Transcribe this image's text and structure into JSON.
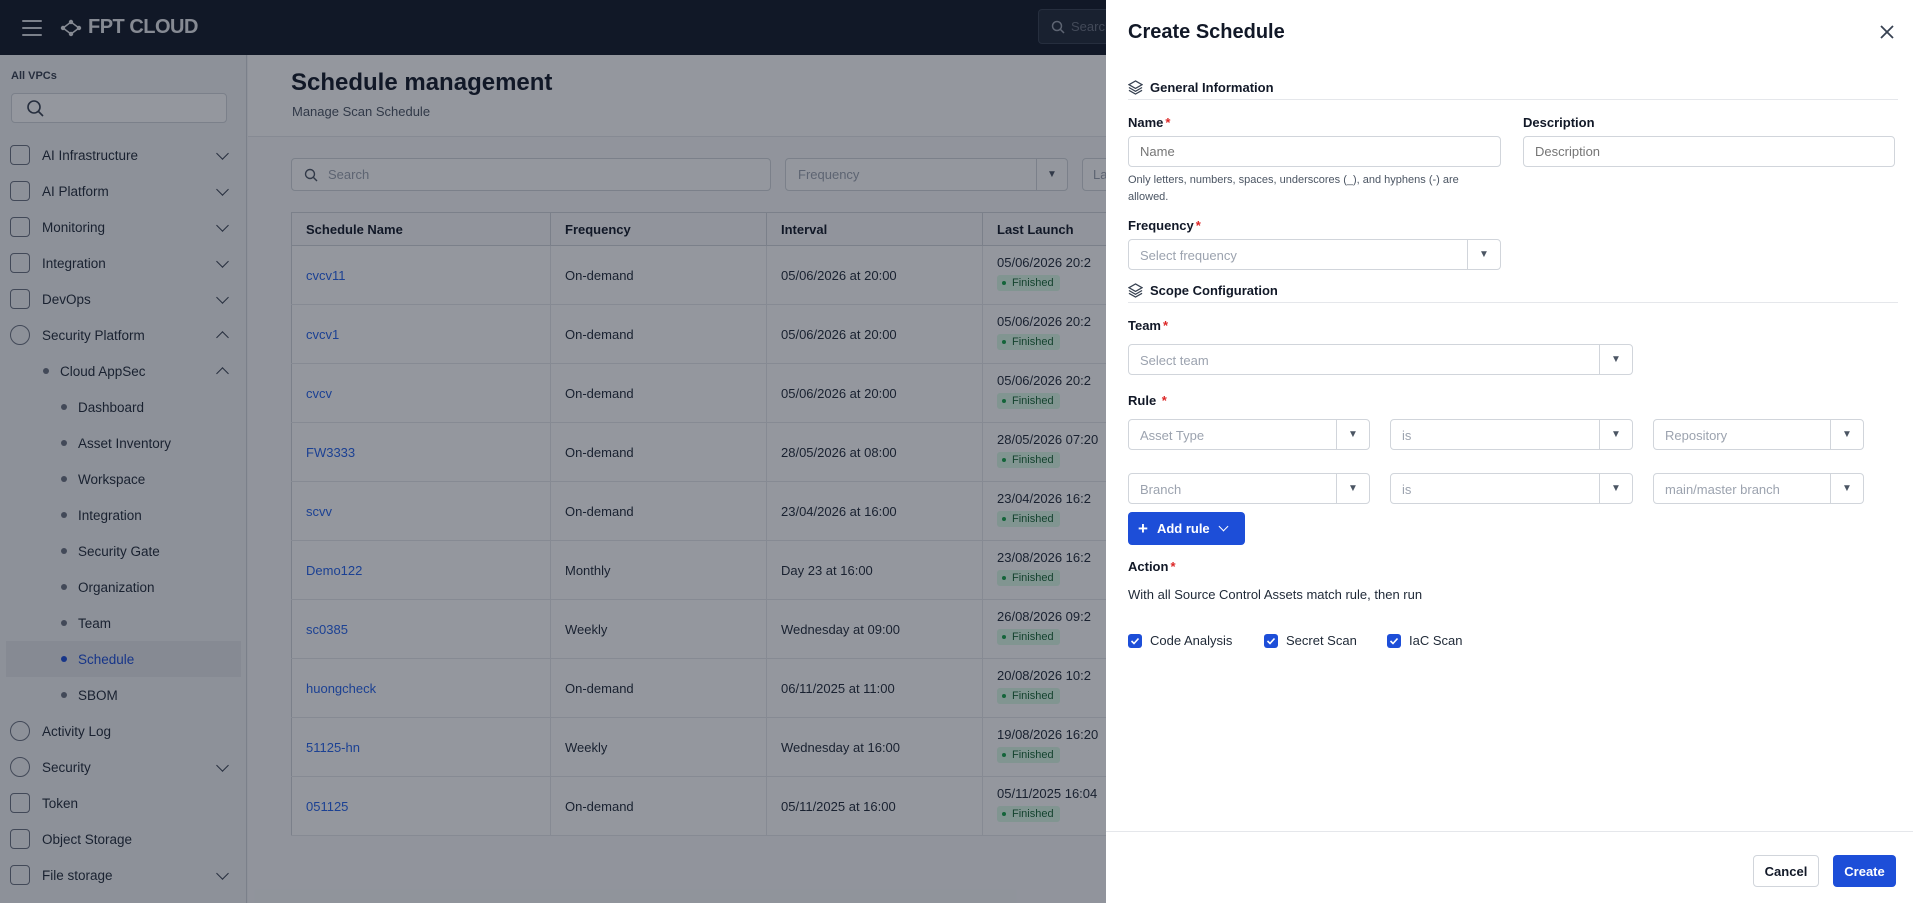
{
  "topbar": {
    "brand": "FPT CLOUD",
    "search_placeholder": "Search"
  },
  "sidebar": {
    "vpc_label": "All VPCs",
    "items": [
      {
        "label": "AI Infrastructure",
        "expand": "down"
      },
      {
        "label": "AI Platform",
        "expand": "down"
      },
      {
        "label": "Monitoring",
        "expand": "down"
      },
      {
        "label": "Integration",
        "expand": "down"
      },
      {
        "label": "DevOps",
        "expand": "down"
      },
      {
        "label": "Security Platform",
        "expand": "up"
      },
      {
        "label": "Cloud AppSec",
        "expand": "up"
      },
      {
        "label": "Dashboard"
      },
      {
        "label": "Asset Inventory"
      },
      {
        "label": "Workspace"
      },
      {
        "label": "Integration"
      },
      {
        "label": "Security Gate"
      },
      {
        "label": "Organization"
      },
      {
        "label": "Team"
      },
      {
        "label": "Schedule"
      },
      {
        "label": "SBOM"
      },
      {
        "label": "Activity Log"
      },
      {
        "label": "Security",
        "expand": "down"
      },
      {
        "label": "Token"
      },
      {
        "label": "Object Storage"
      },
      {
        "label": "File storage",
        "expand": "down"
      }
    ]
  },
  "page": {
    "title": "Schedule management",
    "subtitle": "Manage Scan Schedule",
    "search_placeholder": "Search",
    "frequency_placeholder": "Frequency",
    "last_placeholder": "La"
  },
  "table": {
    "headers": [
      "Schedule Name",
      "Frequency",
      "Interval",
      "Last Launch"
    ],
    "rows": [
      {
        "name": "cvcv11",
        "frequency": "On-demand",
        "interval": "05/06/2026 at 20:00",
        "last_launch": "05/06/2026 20:2",
        "status": "Finished"
      },
      {
        "name": "cvcv1",
        "frequency": "On-demand",
        "interval": "05/06/2026 at 20:00",
        "last_launch": "05/06/2026 20:2",
        "status": "Finished"
      },
      {
        "name": "cvcv",
        "frequency": "On-demand",
        "interval": "05/06/2026 at 20:00",
        "last_launch": "05/06/2026 20:2",
        "status": "Finished"
      },
      {
        "name": "FW3333",
        "frequency": "On-demand",
        "interval": "28/05/2026 at 08:00",
        "last_launch": "28/05/2026 07:20",
        "status": "Finished"
      },
      {
        "name": "scvv",
        "frequency": "On-demand",
        "interval": "23/04/2026 at 16:00",
        "last_launch": "23/04/2026 16:2",
        "status": "Finished"
      },
      {
        "name": "Demo122",
        "frequency": "Monthly",
        "interval": "Day 23 at 16:00",
        "last_launch": "23/08/2026 16:2",
        "status": "Finished"
      },
      {
        "name": "sc0385",
        "frequency": "Weekly",
        "interval": "Wednesday at 09:00",
        "last_launch": "26/08/2026 09:2",
        "status": "Finished"
      },
      {
        "name": "huongcheck",
        "frequency": "On-demand",
        "interval": "06/11/2025 at 11:00",
        "last_launch": "20/08/2026 10:2",
        "status": "Finished"
      },
      {
        "name": "51125-hn",
        "frequency": "Weekly",
        "interval": "Wednesday at 16:00",
        "last_launch": "19/08/2026 16:20",
        "status": "Finished"
      },
      {
        "name": "051125",
        "frequency": "On-demand",
        "interval": "05/11/2025 at 16:00",
        "last_launch": "05/11/2025 16:04",
        "status": "Finished"
      }
    ]
  },
  "drawer": {
    "title": "Create Schedule",
    "general_section": "General Information",
    "name_label": "Name",
    "name_placeholder": "Name",
    "name_hint": "Only letters, numbers, spaces, underscores (_), and hyphens (-) are allowed.",
    "description_label": "Description",
    "description_placeholder": "Description",
    "frequency_label": "Frequency",
    "frequency_placeholder": "Select frequency",
    "scope_section": "Scope Configuration",
    "team_label": "Team",
    "team_placeholder": "Select team",
    "rule_label": "Rule",
    "rules": [
      {
        "field": "Asset Type",
        "operator": "is",
        "value": "Repository"
      },
      {
        "field": "Branch",
        "operator": "is",
        "value": "main/master branch"
      }
    ],
    "add_rule_label": "Add rule",
    "action_label": "Action",
    "action_text": "With all Source Control Assets match rule, then run",
    "checkboxes": [
      {
        "label": "Code Analysis",
        "checked": true
      },
      {
        "label": "Secret Scan",
        "checked": true
      },
      {
        "label": "IaC Scan",
        "checked": true
      }
    ],
    "cancel_label": "Cancel",
    "create_label": "Create"
  },
  "colors": {
    "primary": "#1d4ed8",
    "topbar": "#111827",
    "finished_badge": "#dcfce7",
    "required": "#dc2626"
  }
}
